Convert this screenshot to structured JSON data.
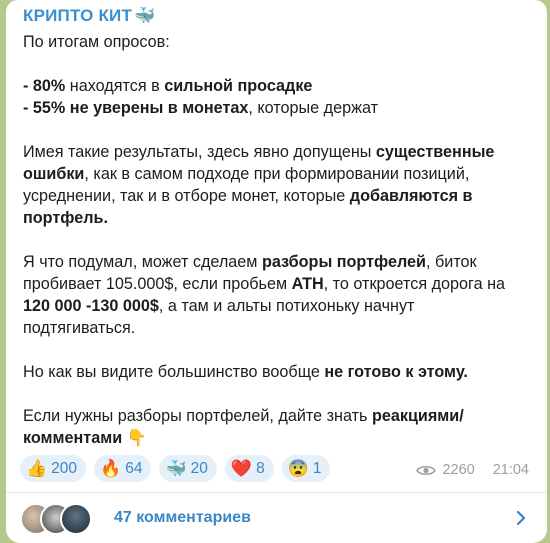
{
  "post": {
    "channel_name": "КРИПТО КИТ",
    "channel_emoji": "🐳",
    "intro": "По итогам опросов:",
    "list": [
      {
        "pct": "- 80%",
        "mid": " находятся в ",
        "bold": "сильной просадке",
        "tail": ""
      },
      {
        "pct": "- 55%",
        "mid": " ",
        "bold": "не уверены в монетах",
        "tail": ", которые держат"
      }
    ],
    "para1": {
      "a": "Имея такие результаты, здесь явно допущены ",
      "b": "существенные ошибки",
      "c": ", как в самом подходе при формировании позиций, усреднении, так и в отборе монет, которые ",
      "d": "добавляются в портфель."
    },
    "para2": {
      "a": "Я что подумал, может сделаем ",
      "b": "разборы портфелей",
      "c": ", биток пробивает 105.000$, если пробьем ",
      "d": "ATH",
      "e": ", то откроется дорога на ",
      "f": "120 000 -130 000$",
      "g": ", а там и альты потихоньку начнут подтягиваться."
    },
    "para3": {
      "a": "Но как вы видите большинство вообще ",
      "b": "не готово к этому."
    },
    "para4": {
      "a": "Если нужны разборы портфелей, дайте знать ",
      "b": "реакциями/комментами",
      "c": " 👇"
    }
  },
  "reactions": [
    {
      "emoji": "👍",
      "count": "200"
    },
    {
      "emoji": "🔥",
      "count": "64"
    },
    {
      "emoji": "🐳",
      "count": "20"
    },
    {
      "emoji": "❤️",
      "count": "8"
    },
    {
      "emoji": "😨",
      "count": "1"
    }
  ],
  "meta": {
    "views": "2260",
    "time": "21:04",
    "icon": "eye-icon"
  },
  "comments": {
    "label": "47 комментариев",
    "icon": "chevron-right-icon"
  },
  "colors": {
    "accent": "#3a86c6",
    "background": "#b7c88f",
    "reaction_bg": "#e6f0f8"
  }
}
